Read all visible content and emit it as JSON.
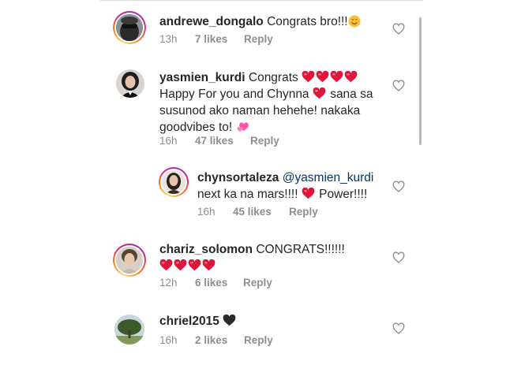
{
  "comments": [
    {
      "username": "andrewe_dongalo",
      "text": "Congrats bro!!!",
      "emoji_suffix": "smiling-face",
      "time": "13h",
      "likes": "7 likes",
      "reply": "Reply"
    },
    {
      "username": "yasmien_kurdi",
      "text_line1": "Congrats",
      "text_line2a": "Happy For you and Chynna",
      "text_line2b": "sana sa",
      "text_line3": "susunod ako naman hehehe! nakaka",
      "text_line4": "goodvibes to!",
      "time": "16h",
      "likes": "47 likes",
      "reply": "Reply"
    },
    {
      "username": "chynsortaleza",
      "mention": "@yasmien_kurdi",
      "text_line2a": "next ka na mars!!!!",
      "text_line2b": "Power!!!!",
      "time": "16h",
      "likes": "45 likes",
      "reply": "Reply"
    },
    {
      "username": "chariz_solomon",
      "text": "CONGRATS!!!!!!",
      "time": "12h",
      "likes": "6 likes",
      "reply": "Reply"
    },
    {
      "username": "chriel2015",
      "time": "16h",
      "likes": "2 likes",
      "reply": "Reply"
    }
  ],
  "colors": {
    "heart_red": "#e0153a",
    "heart_pink": "#ff4fa3",
    "black_heart": "#2b2b2b",
    "meta_gray": "#8e8e8e"
  },
  "icons": [
    "like-heart-outline-icon",
    "red-heart-emoji",
    "sparkling-heart-emoji",
    "black-heart-emoji",
    "smiling-face-emoji"
  ]
}
